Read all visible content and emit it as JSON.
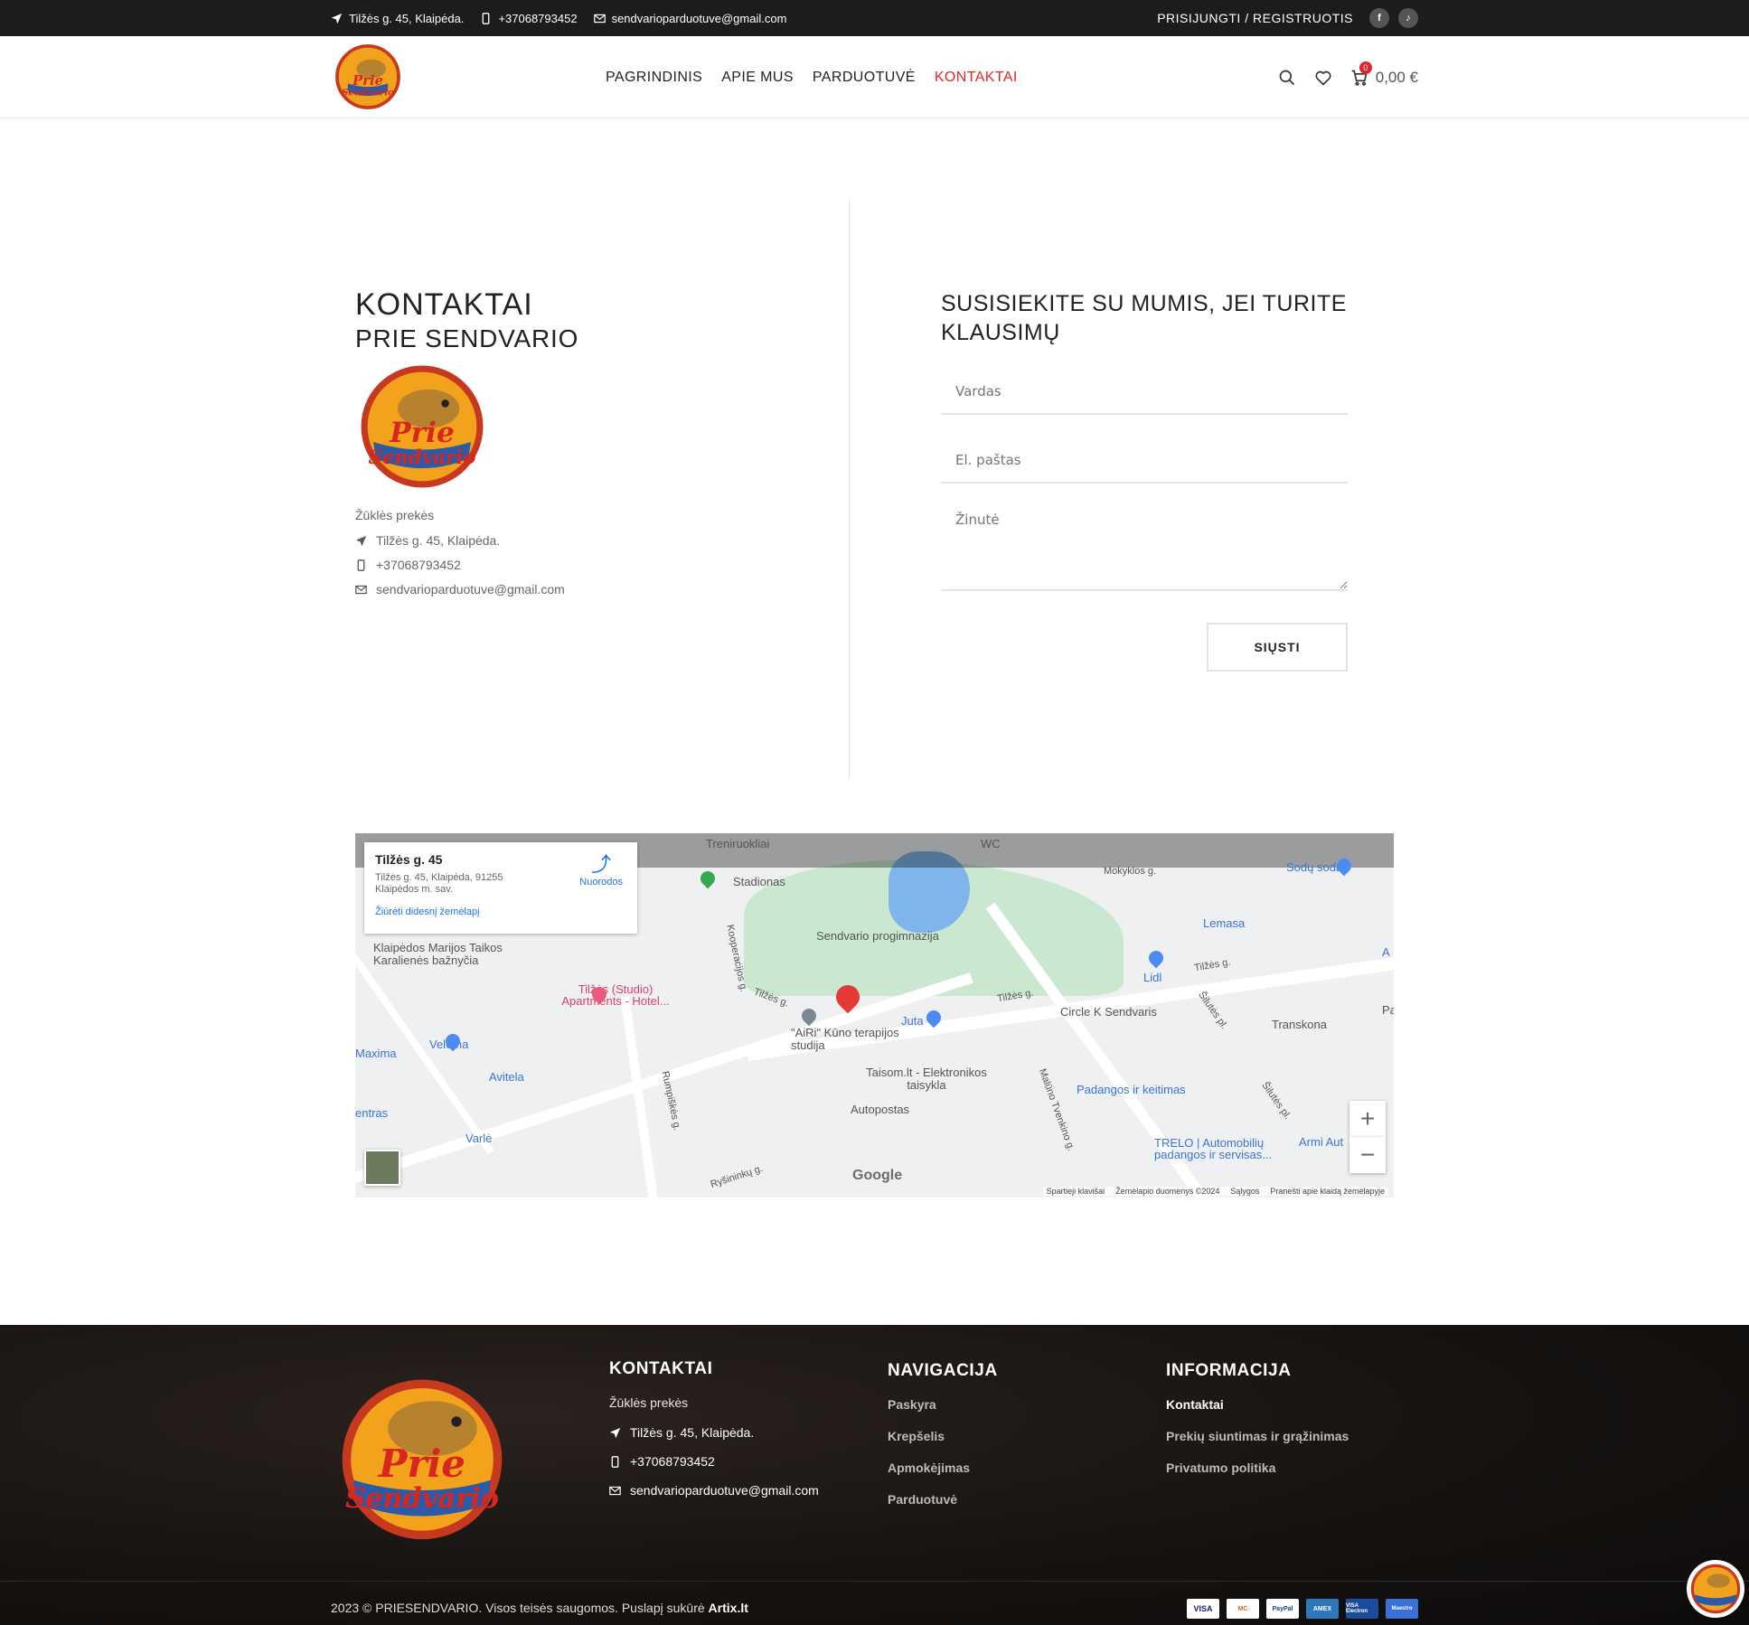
{
  "topbar": {
    "address": "Tilžės g. 45, Klaipėda.",
    "phone": "+37068793452",
    "email": "sendvarioparduotuve@gmail.com",
    "login": "PRISIJUNGTI / REGISTRUOTIS",
    "social": [
      {
        "icon": "facebook-icon",
        "glyph": "f"
      },
      {
        "icon": "tiktok-icon",
        "glyph": "♪"
      }
    ]
  },
  "header": {
    "logo_text": "Prie Sendvario",
    "nav": [
      {
        "label": "PAGRINDINIS",
        "active": false
      },
      {
        "label": "APIE MUS",
        "active": false
      },
      {
        "label": "PARDUOTUVĖ",
        "active": false
      },
      {
        "label": "KONTAKTAI",
        "active": true
      }
    ],
    "cart_count": "0",
    "cart_total": "0,00 €"
  },
  "contact": {
    "title": "KONTAKTAI",
    "subtitle": "PRIE SENDVARIO",
    "category": "Žūklės prekės",
    "address": "Tilžės g. 45, Klaipėda.",
    "phone": "+37068793452",
    "email": "sendvarioparduotuve@gmail.com"
  },
  "form": {
    "heading": "SUSISIEKITE SU MUMIS, JEI TURITE KLAUSIMŲ",
    "name_placeholder": "Vardas",
    "email_placeholder": "El. paštas",
    "message_placeholder": "Žinutė",
    "submit": "SIŲSTI"
  },
  "map": {
    "info_title": "Tilžės g. 45",
    "info_address": "Tilžės g. 45, Klaipėda, 91255 Klaipėdos m. sav.",
    "info_link": "Žiūrėti didesnį žemėlapį",
    "directions": "Nuorodos",
    "labels": {
      "treniruokliai": "Treniruokliai",
      "wc": "WC",
      "stadionas": "Stadionas",
      "sodu_sodas": "Sodų sodas",
      "morykl": "Mokyklos g.",
      "lemasa": "Lemasa",
      "progimnazija": "Sendvario progimnazija",
      "kooperacijos": "Kooperacijos g.",
      "tilzes1": "Tilžės g.",
      "tilzes2": "Tilžės g.",
      "tilzes3": "Tilžės g.",
      "lidl": "Lidl",
      "silutes1": "Šilutės pl.",
      "silutes2": "Šilutės pl.",
      "circlek": "Circle K Sendvaris",
      "transkona": "Transkona",
      "baznycia": "Klaipėdos Marijos Taikos Karalienės bažnyčia",
      "studio": "Tilžės (Studio) Apartments - Hotel...",
      "juta": "Juta",
      "airi": "\"AiRi\" Kūno terapijos studija",
      "veloma": "Veloma",
      "maxima": "Maxima",
      "avitela": "Avitela",
      "taisom": "Taisom.lt - Elektronikos taisykla",
      "autopostas": "Autopostas",
      "padangos": "Padangos ir keitimas",
      "centras": "entras",
      "varle": "Varlė",
      "rumpiskes": "Rumpiškės g.",
      "rysininku": "Ryšininkų g.",
      "malunas": "Malūno Tvenkino g.",
      "trelo": "TRELO | Automobilių padangos ir servisas...",
      "armi": "Armi Aut",
      "a_right": "A",
      "p_right": "Pa"
    },
    "google": "Google",
    "foot": [
      "Spartieji klavišai",
      "Žemėlapio duomenys ©2024",
      "Sąlygos",
      "Pranešti apie klaidą žemėlapyje"
    ]
  },
  "footer": {
    "kontaktai": {
      "title": "KONTAKTAI",
      "category": "Žūklės prekės",
      "address": "Tilžės g. 45, Klaipėda.",
      "phone": "+37068793452",
      "email": "sendvarioparduotuve@gmail.com"
    },
    "navigacija": {
      "title": "NAVIGACIJA",
      "links": [
        "Paskyra",
        "Krepšelis",
        "Apmokėjimas",
        "Parduotuvė"
      ]
    },
    "informacija": {
      "title": "INFORMACIJA",
      "links": [
        "Kontaktai",
        "Prekių siuntimas ir grąžinimas",
        "Privatumo politika"
      ]
    },
    "copyright_text": "2023 © PRIESENDVARIO. Visos teisės saugomos. Puslapį sukūrė",
    "copyright_brand": "Artix.lt",
    "payments": [
      {
        "name": "VISA",
        "color": "#1a1f71"
      },
      {
        "name": "MC",
        "color": "#eb5f2a"
      },
      {
        "name": "PayPal",
        "color": "#ffffff"
      },
      {
        "name": "AMEX",
        "color": "#2e77bb"
      },
      {
        "name": "VISA Electron",
        "color": "#1a4b9c"
      },
      {
        "name": "Maestro",
        "color": "#3a6fd8"
      }
    ]
  }
}
